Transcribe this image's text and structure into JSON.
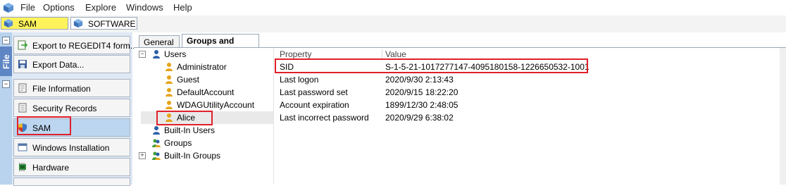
{
  "menu": [
    "File",
    "Options",
    "Explore",
    "Windows",
    "Help"
  ],
  "hive_tabs": [
    {
      "label": "SAM",
      "active": true,
      "color": "#fff35b"
    },
    {
      "label": "SOFTWARE",
      "active": false
    }
  ],
  "left_panel": {
    "tab_label": "File",
    "top_buttons": [
      "Export to REGEDIT4 form...",
      "Export Data..."
    ],
    "nav_buttons": [
      "File Information",
      "Security Records",
      "SAM",
      "Windows Installation",
      "Hardware"
    ],
    "active_nav": "SAM"
  },
  "content_tabs": [
    "General",
    "Groups and Users"
  ],
  "tree": {
    "users_label": "Users",
    "users": [
      "Administrator",
      "Guest",
      "DefaultAccount",
      "WDAGUtilityAccount",
      "Alice"
    ],
    "selected_user": "Alice",
    "others": [
      "Built-In Users",
      "Groups",
      "Built-In Groups"
    ]
  },
  "properties": {
    "header": {
      "property": "Property",
      "value": "Value"
    },
    "rows": [
      {
        "name": "SID",
        "value": "S-1-5-21-1017277147-4095180158-1226650532-1001"
      },
      {
        "name": "Last logon",
        "value": "2020/9/30 2:13:43"
      },
      {
        "name": "Last password set",
        "value": "2020/9/15 18:22:20"
      },
      {
        "name": "Account expiration",
        "value": "1899/12/30 2:48:05"
      },
      {
        "name": "Last incorrect password",
        "value": "2020/9/29 6:38:02"
      }
    ]
  },
  "colors": {
    "highlight": "#e0202a",
    "accent": "#5f86c4",
    "sam_tab": "#fff35b"
  }
}
